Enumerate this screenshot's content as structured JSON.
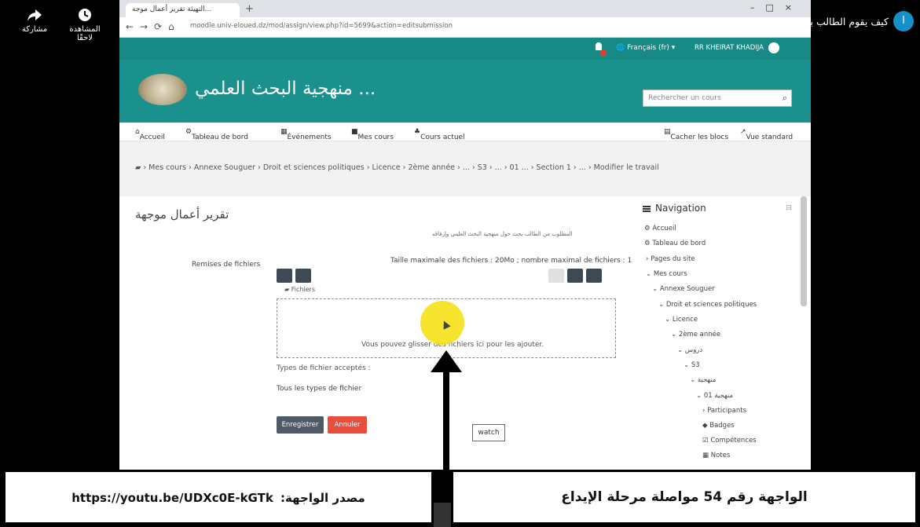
{
  "yt": {
    "share_label": "مشاركة",
    "watch_later_label": "المشاهدة لاحقًا",
    "video_title": "كيف يقوم الطالب بتحميل المحاضرات وتسليم الواجبات للأستاذ على منصة مودل",
    "channel_avatar_letter": "ا"
  },
  "browser": {
    "tab_title": "التهيئة تقرير أعمال موجه...",
    "url": "moodle.univ-eloued.dz/mod/assign/view.php?id=5699&action=editsubmission"
  },
  "moodle": {
    "language": "Français (fr)",
    "user_name": "RR KHEIRAT KHADIJA",
    "site_title": "... منهجية البحث العلمي",
    "search_placeholder": "Rechercher un cours",
    "nav": {
      "home": "Accueil",
      "dashboard": "Tableau de bord",
      "events": "Événements",
      "my_courses": "Mes cours",
      "current_course": "Cours actuel",
      "hide_blocks": "Cacher les blocs",
      "standard_view": "Vue standard"
    },
    "breadcrumb": "Mes cours › Annexe Souguer › Droit et sciences politiques › Licence › 2ème année › ... › S3 › ... › 01 ... › Section 1 › ... › Modifier le travail",
    "page_title": "تقرير أعمال موجهة",
    "description": "المطلوب من الطالب بحث حول منهجية البحث العلمي وإرفاقه",
    "files_label": "Remises de fichiers",
    "max_size": "Taille maximale des fichiers : 20Mo ; nombre maximal de fichiers : 1",
    "folder_path": "Fichiers",
    "drop_text": "Vous pouvez glisser des fichiers ici pour les ajouter.",
    "accepted_types_label": "Types de fichier acceptés :",
    "accepted_types_value": "Tous les types de fichier",
    "save_button": "Enregistrer",
    "cancel_button": "Annuler",
    "sidebar": {
      "title": "Navigation",
      "items": [
        "Accueil",
        "Tableau de bord",
        "Pages du site",
        "Mes cours",
        "Annexe Souguer",
        "Droit et sciences politiques",
        "Licence",
        "2ème année",
        "دروس",
        "S3",
        "منهجية",
        "منهجية 01",
        "Participants",
        "Badges",
        "Compétences",
        "Notes"
      ]
    }
  },
  "watch_label": "watch",
  "captions": {
    "source_label": "مصدر الواجهة:",
    "source_url": "https://youtu.be/UDXc0E-kGTk",
    "interface_text": "الواجهة رقم 54  مواصلة مرحلة الإيداع"
  },
  "colors": {
    "moodle_teal": "#188a85",
    "cancel_red": "#e84e3c",
    "highlight_yellow": "#f5e21c"
  }
}
